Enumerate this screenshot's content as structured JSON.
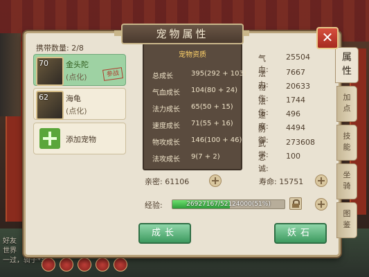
{
  "window": {
    "title": "宠物属性"
  },
  "pets": {
    "count_label": "携带数量: 2/8",
    "list": [
      {
        "level": "70",
        "name": "金头陀",
        "sub": "(点化)",
        "badge": "参战",
        "selected": true
      },
      {
        "level": "62",
        "name": "海龟",
        "sub": "(点化)",
        "badge": "",
        "selected": false
      }
    ],
    "add_label": "添加宠物"
  },
  "growth": {
    "header": "宠物资质",
    "rows": [
      {
        "label": "总成长",
        "value": "395(292 + 103)"
      },
      {
        "label": "气血成长",
        "value": "104(80 + 24)"
      },
      {
        "label": "法力成长",
        "value": "65(50 + 15)"
      },
      {
        "label": "速度成长",
        "value": "71(55 + 16)"
      },
      {
        "label": "物攻成长",
        "value": "146(100 + 46)"
      },
      {
        "label": "法攻成长",
        "value": "9(7 + 2)"
      }
    ]
  },
  "stats": [
    {
      "label": "气血:",
      "value": "25504"
    },
    {
      "label": "法力:",
      "value": "7667"
    },
    {
      "label": "物伤:",
      "value": "20633"
    },
    {
      "label": "法伤:",
      "value": "1744"
    },
    {
      "label": "速度:",
      "value": "496"
    },
    {
      "label": "防御:",
      "value": "4494"
    },
    {
      "label": "武学:",
      "value": "273608"
    },
    {
      "label": "忠诚:",
      "value": "100"
    }
  ],
  "intimacy": {
    "label": "亲密: 61106"
  },
  "life": {
    "label": "寿命: 15751"
  },
  "exp": {
    "label": "经验:",
    "text": "26927167/52124000(51%)",
    "progress_percent": 51
  },
  "buttons": {
    "grow": "成长",
    "pill": "妖石"
  },
  "tabs": [
    {
      "label": "属性",
      "active": true
    },
    {
      "label": "加点",
      "active": false
    },
    {
      "label": "技能",
      "active": false
    },
    {
      "label": "坐骑",
      "active": false
    },
    {
      "label": "图鉴",
      "active": false
    }
  ],
  "chat": {
    "lines": [
      "好友",
      "世界",
      "一过，骑子*至。"
    ]
  },
  "icons": {
    "close": "close-icon",
    "plus": "plus-icon",
    "lock": "lock-icon",
    "add": "add-pet-icon"
  }
}
